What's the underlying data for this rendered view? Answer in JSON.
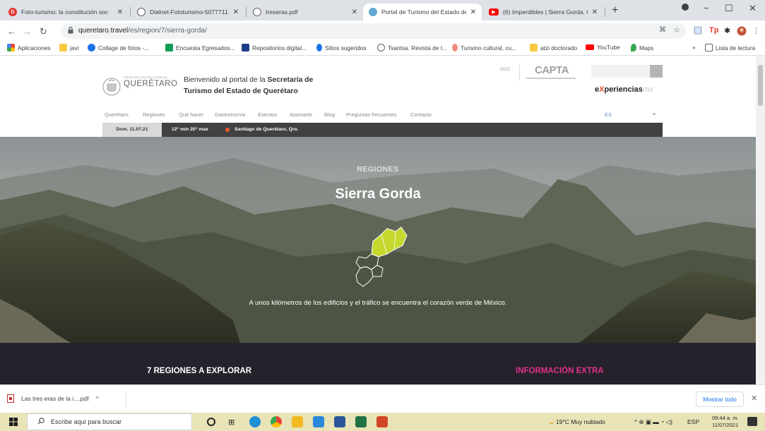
{
  "browser": {
    "tabs": [
      {
        "title": "Foto-turismo: la constitución soc",
        "favicon_color": "#e53935",
        "favicon": "D"
      },
      {
        "title": "Dialnet-Fototurismo-5077711.pd",
        "favicon_color": "#5f6368",
        "favicon": ""
      },
      {
        "title": "treseras.pdf",
        "favicon_color": "#5f6368",
        "favicon": ""
      },
      {
        "title": "Portal de Turismo del Estado de",
        "favicon_color": "#5fa8d3",
        "favicon": ""
      },
      {
        "title": "(6) Imperdibles | Sierra Gorda, Q",
        "favicon_color": "#ff0000",
        "favicon": "▶"
      }
    ],
    "new_tab": "+",
    "window": {
      "minimize": "−",
      "maximize": "☐",
      "close": "✕"
    },
    "address": {
      "host": "queretaro.travel",
      "path": "/es/region/7/sierra-gorda/"
    },
    "bookmarks": [
      {
        "label": "Aplicaciones",
        "color": "#ea4335"
      },
      {
        "label": "javi",
        "color": "#f9c940"
      },
      {
        "label": "Collage de fotos -...",
        "color": "#1a73e8"
      },
      {
        "label": "Encuesta Egresados...",
        "color": "#0f9d58"
      },
      {
        "label": "Repositorios digital...",
        "color": "#1f3b8b"
      },
      {
        "label": "Sitios sugeridos",
        "color": "#1a73e8"
      },
      {
        "label": "Tsantsa. Revista de I...",
        "color": "#5f6368"
      },
      {
        "label": "Turismo cultural, cu...",
        "color": "#f28b82"
      },
      {
        "label": "atzi doctorado",
        "color": "#f9c940"
      },
      {
        "label": "YouTube",
        "color": "#ff0000"
      },
      {
        "label": "Maps",
        "color": "#34a853"
      }
    ],
    "bookmarks_more": "»",
    "reading_list": "Lista de lectura"
  },
  "site": {
    "logo_text": "QUERÉTARO",
    "welcome_line1_prefix": "Bienvenido al portal de la ",
    "welcome_line1_bold": "Secretaría de",
    "welcome_line2": "Turismo del Estado de Querétaro",
    "occ": "OCC",
    "capta": "CAPTA",
    "experiencias_e": "e",
    "experiencias_x": "X",
    "experiencias_rest": "periencias",
    "experiencias_mx": "mx",
    "nav": [
      "Querétaro",
      "Regiones",
      "Qué hacer",
      "Gastronomía",
      "Eventos",
      "Asomarte",
      "Blog",
      "Preguntas frecuentes",
      "Contacto"
    ],
    "lang": "ES",
    "weather": {
      "date": "Dom. 11.07.21",
      "temps": "12° min   20° max",
      "city": "Santiago de Querétaro, Qro."
    },
    "hero": {
      "kicker": "REGIONES",
      "title": "Sierra Gorda",
      "subtitle": "A unos kilómetros de los edificios y el tráfico se encuentra el corazón verde de México."
    },
    "regions_heading": "7 REGIONES A EXPLORAR",
    "info_heading": "INFORMACIÓN EXTRA"
  },
  "download": {
    "filename": "Las tres eras de la i....pdf",
    "show_all": "Mostrar todo"
  },
  "taskbar": {
    "search_placeholder": "Escribe aquí para buscar",
    "weather": "19°C  Muy nublado",
    "lang": "ESP",
    "time": "09:44 a. m.",
    "date": "11/07/2021"
  }
}
